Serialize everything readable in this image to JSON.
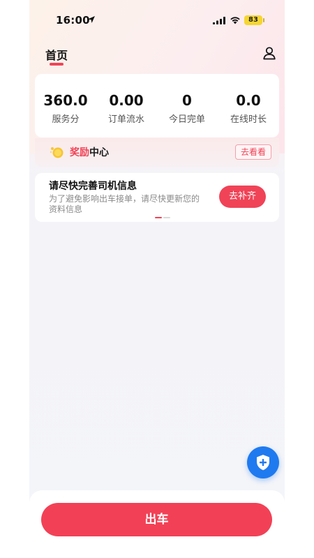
{
  "status_bar": {
    "time": "16:00",
    "battery": "83"
  },
  "header": {
    "tab_home": "首页"
  },
  "stats": [
    {
      "value": "360.0",
      "label": "服务分"
    },
    {
      "value": "0.00",
      "label": "订单流水"
    },
    {
      "value": "0",
      "label": "今日完单"
    },
    {
      "value": "0.0",
      "label": "在线时长"
    }
  ],
  "reward": {
    "title_red": "奖励",
    "title_dark": "中心",
    "button_label": "去看看"
  },
  "info_card": {
    "title": "请尽快完善司机信息",
    "description": "为了避免影响出车接单，请尽快更新您的资料信息",
    "button_label": "去补齐"
  },
  "bottom": {
    "depart_label": "出车"
  },
  "colors": {
    "accent_red": "#f04357",
    "fab_blue": "#1f7af0",
    "battery_yellow": "#f5d631"
  },
  "icons": [
    "location-arrow-icon",
    "signal-icon",
    "wifi-icon",
    "user-icon",
    "coin-icon",
    "shield-plus-icon"
  ]
}
